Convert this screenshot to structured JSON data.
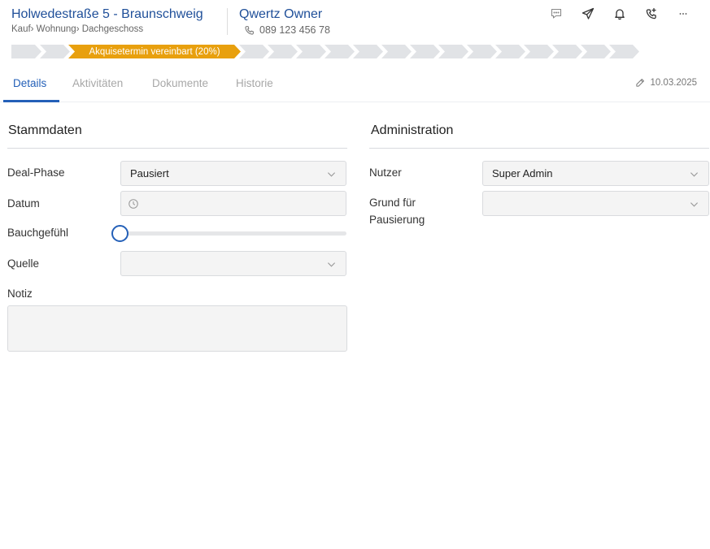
{
  "header": {
    "property_title": "Holwedestraße 5 - Braunschweig",
    "breadcrumb": "Kauf› Wohnung› Dachgeschoss",
    "contact_name": "Qwertz Owner",
    "contact_phone": "089 123 456 78",
    "icons": [
      "chat-icon",
      "send-icon",
      "bell-icon",
      "phone-forward-icon",
      "more-icon"
    ]
  },
  "stages": {
    "active_label": "Akquisetermin vereinbart (20%)",
    "active_color": "#e8a00e",
    "inactive_color": "#e1e3e6",
    "total_count": 17,
    "active_index": 2
  },
  "tabs": {
    "items": [
      "Details",
      "Aktivitäten",
      "Dokumente",
      "Historie"
    ],
    "active": "Details",
    "edit_date": "10.03.2025"
  },
  "stammdaten": {
    "title": "Stammdaten",
    "deal_phase_label": "Deal-Phase",
    "deal_phase_value": "Pausiert",
    "datum_label": "Datum",
    "datum_value": "",
    "bauchgefuehl_label": "Bauchgefühl",
    "bauchgefuehl_value": 0,
    "quelle_label": "Quelle",
    "quelle_value": "",
    "notiz_label": "Notiz",
    "notiz_value": ""
  },
  "administration": {
    "title": "Administration",
    "nutzer_label": "Nutzer",
    "nutzer_value": "Super Admin",
    "grund_label": "Grund für Pausierung",
    "grund_value": ""
  },
  "colors": {
    "accent": "#2460b8",
    "title_blue": "#1f4f99"
  }
}
